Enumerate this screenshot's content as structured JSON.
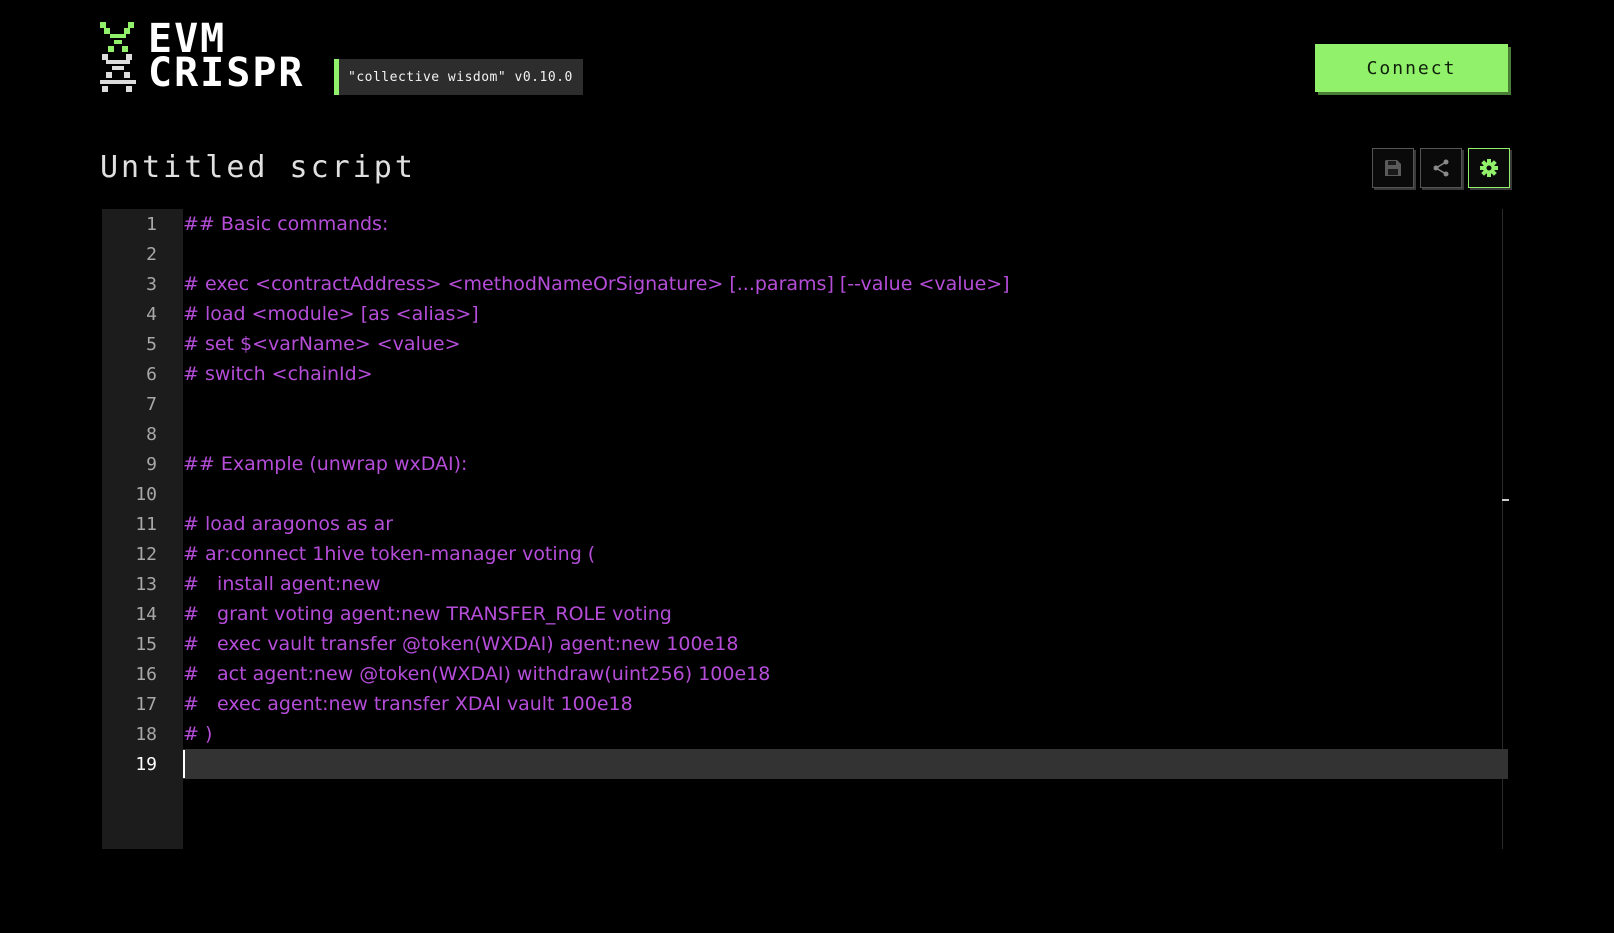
{
  "header": {
    "logo_line1": "EVM",
    "logo_line2": "CRISPR",
    "version": "\"collective wisdom\" v0.10.0",
    "connect_label": "Connect"
  },
  "script": {
    "title": "Untitled script"
  },
  "toolbar": {
    "buttons": [
      {
        "icon": "save-icon"
      },
      {
        "icon": "share-icon"
      },
      {
        "icon": "gear-icon",
        "active": true
      }
    ]
  },
  "editor": {
    "current_line": 19,
    "lines": [
      {
        "n": "1",
        "text": "## Basic commands:"
      },
      {
        "n": "2",
        "text": ""
      },
      {
        "n": "3",
        "text": "# exec <contractAddress> <methodNameOrSignature> [...params] [--value <value>]"
      },
      {
        "n": "4",
        "text": "# load <module> [as <alias>]"
      },
      {
        "n": "5",
        "text": "# set $<varName> <value>"
      },
      {
        "n": "6",
        "text": "# switch <chainId>"
      },
      {
        "n": "7",
        "text": ""
      },
      {
        "n": "8",
        "text": ""
      },
      {
        "n": "9",
        "text": "## Example (unwrap wxDAI):"
      },
      {
        "n": "10",
        "text": ""
      },
      {
        "n": "11",
        "text": "# load aragonos as ar"
      },
      {
        "n": "12",
        "text": "# ar:connect 1hive token-manager voting ("
      },
      {
        "n": "13",
        "text": "#   install agent:new"
      },
      {
        "n": "14",
        "text": "#   grant voting agent:new TRANSFER_ROLE voting"
      },
      {
        "n": "15",
        "text": "#   exec vault transfer @token(WXDAI) agent:new 100e18"
      },
      {
        "n": "16",
        "text": "#   act agent:new @token(WXDAI) withdraw(uint256) 100e18"
      },
      {
        "n": "17",
        "text": "#   exec agent:new transfer XDAI vault 100e18"
      },
      {
        "n": "18",
        "text": "# )"
      },
      {
        "n": "19",
        "text": ""
      }
    ]
  },
  "colors": {
    "accent": "#92f16b",
    "code": "#b54dd9",
    "background": "#000000",
    "gutter": "#1c1c1c",
    "current_line": "#333333"
  }
}
